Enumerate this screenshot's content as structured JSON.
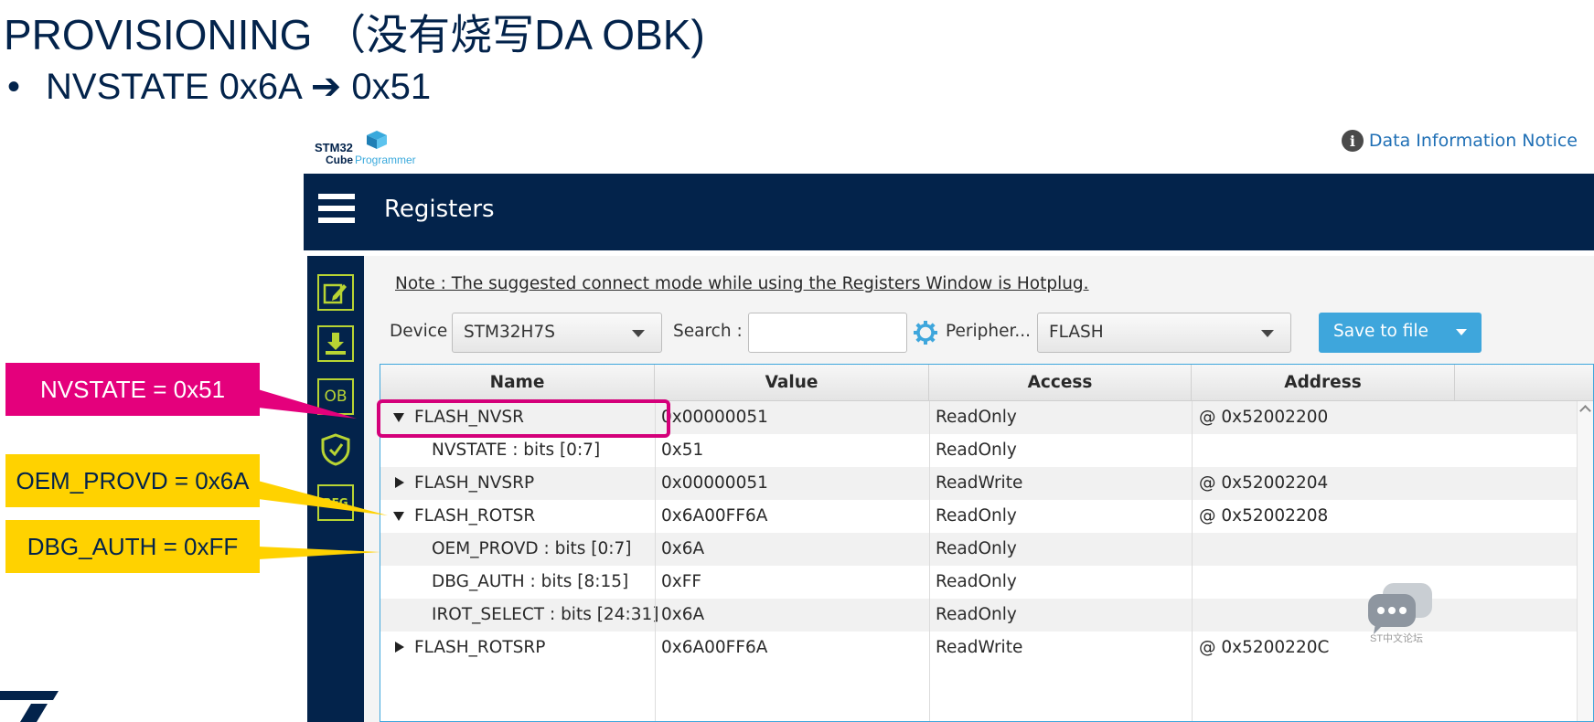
{
  "slide": {
    "title": "PROVISIONING （没有烧写DA OBK)",
    "bullet_symbol": "•",
    "bullet_text": "NVSTATE 0x6A ➔ 0x51"
  },
  "app": {
    "logo_line1": "STM32",
    "logo_cube": "Cube",
    "logo_prog": "Programmer",
    "notice_label": "Data Information Notice",
    "notice_icon": "info-icon",
    "page_title": "Registers",
    "sidebar_items": [
      {
        "name": "sidebar-item-memory-edit",
        "icon": "pencil-icon",
        "label": ""
      },
      {
        "name": "sidebar-item-download",
        "icon": "download-icon",
        "label": ""
      },
      {
        "name": "sidebar-item-option-bytes",
        "icon": "ob-icon",
        "label": "OB"
      },
      {
        "name": "sidebar-item-security",
        "icon": "shield-icon",
        "label": ""
      },
      {
        "name": "sidebar-item-registers",
        "icon": "reg-icon",
        "label": "REG"
      }
    ],
    "note": "Note : The suggested connect mode while using the Registers Window is Hotplug.",
    "device_label": "Device :",
    "device_value": "STM32H7S",
    "search_label": "Search :",
    "search_value": "",
    "peripheral_label": "Peripher...",
    "peripheral_value": "FLASH",
    "save_label": "Save to file"
  },
  "table": {
    "headers": [
      "Name",
      "Value",
      "Access",
      "Address"
    ],
    "rows": [
      {
        "expander": "down",
        "indent": false,
        "name": "FLASH_NVSR",
        "value": "0x00000051",
        "access": "ReadOnly",
        "address": "@ 0x52002200"
      },
      {
        "expander": "none",
        "indent": true,
        "name": "NVSTATE : bits [0:7]",
        "value": "0x51",
        "access": "ReadOnly",
        "address": ""
      },
      {
        "expander": "right",
        "indent": false,
        "name": "FLASH_NVSRP",
        "value": "0x00000051",
        "access": "ReadWrite",
        "address": "@ 0x52002204"
      },
      {
        "expander": "down",
        "indent": false,
        "name": "FLASH_ROTSR",
        "value": "0x6A00FF6A",
        "access": "ReadOnly",
        "address": "@ 0x52002208"
      },
      {
        "expander": "none",
        "indent": true,
        "name": "OEM_PROVD : bits [0:7]",
        "value": "0x6A",
        "access": "ReadOnly",
        "address": ""
      },
      {
        "expander": "none",
        "indent": true,
        "name": "DBG_AUTH : bits [8:15]",
        "value": "0xFF",
        "access": "ReadOnly",
        "address": ""
      },
      {
        "expander": "none",
        "indent": true,
        "name": "IROT_SELECT : bits [24:31]",
        "value": "0x6A",
        "access": "ReadOnly",
        "address": ""
      },
      {
        "expander": "right",
        "indent": false,
        "name": "FLASH_ROTSRP",
        "value": "0x6A00FF6A",
        "access": "ReadWrite",
        "address": "@ 0x5200220C"
      }
    ]
  },
  "callouts": {
    "nvstate": "NVSTATE = 0x51",
    "oem_provd": "OEM_PROVD = 0x6A",
    "dbg_auth": "DBG_AUTH = 0xFF"
  },
  "footer": {
    "forum_text": "ST中文论坛",
    "forum_icon": "chat-bubbles-icon",
    "brand_icon": "st-logo-icon"
  },
  "colors": {
    "navy": "#03234b",
    "accent_blue": "#3ea6dc",
    "callout_pink": "#e4007c",
    "callout_yellow": "#ffd200",
    "sidebar_lime": "#b8d433"
  }
}
